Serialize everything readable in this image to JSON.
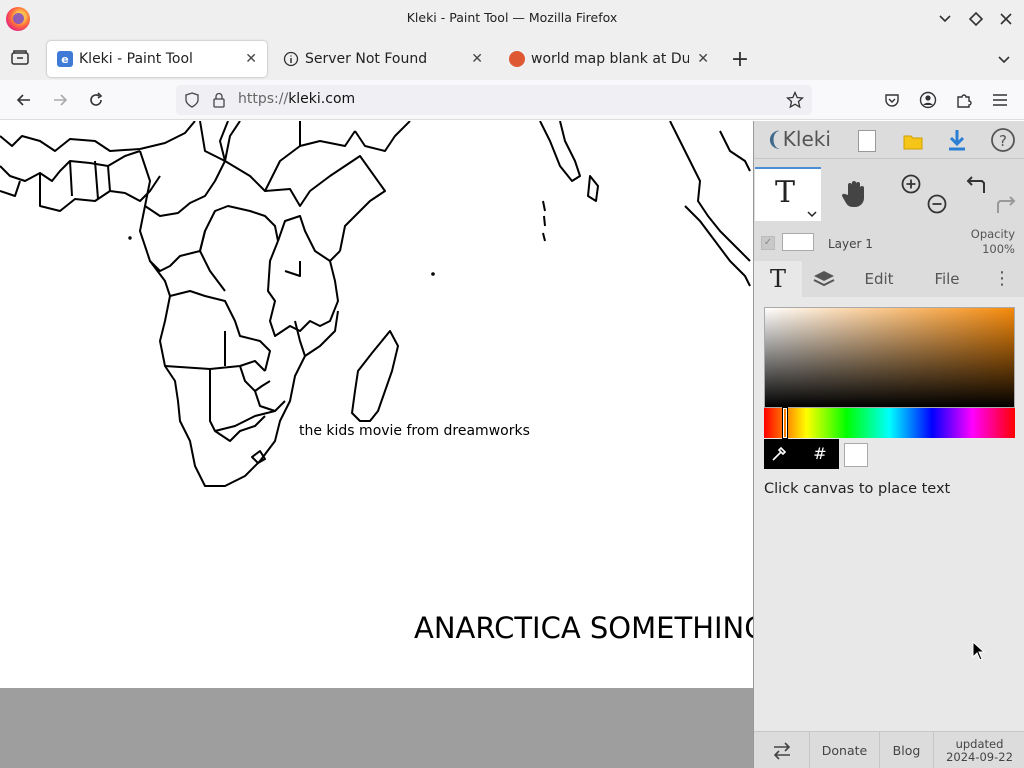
{
  "window": {
    "title": "Kleki - Paint Tool — Mozilla Firefox"
  },
  "tabs": [
    {
      "label": "Kleki - Paint Tool",
      "favicon": "kleki-icon",
      "active": true
    },
    {
      "label": "Server Not Found",
      "favicon": "info-icon",
      "active": false
    },
    {
      "label": "world map blank at Duck",
      "favicon": "duckduckgo-icon",
      "active": false
    }
  ],
  "nav": {
    "url_scheme": "https://",
    "url_host": "kleki.com"
  },
  "canvas": {
    "annotation_small": "the kids movie from dreamworks",
    "annotation_large": "ANARCTICA SOMETHING"
  },
  "panel": {
    "brand": "Kleki",
    "layer_name": "Layer 1",
    "opacity_label": "Opacity",
    "opacity_value": "100%",
    "tabs": {
      "edit": "Edit",
      "file": "File"
    },
    "hex_symbol": "#",
    "hint": "Click canvas to place text",
    "footer": {
      "donate": "Donate",
      "blog": "Blog",
      "updated_label": "updated",
      "updated_date": "2024-09-22"
    },
    "colors": {
      "primary": "#000000",
      "secondary": "#ffffff",
      "hue": "#f68a0b"
    }
  }
}
